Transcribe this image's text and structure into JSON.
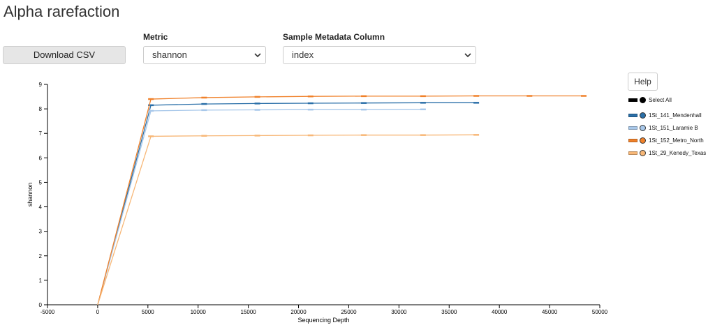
{
  "page": {
    "title": "Alpha rarefaction"
  },
  "controls": {
    "download_label": "Download CSV",
    "metric_label": "Metric",
    "metric_value": "shannon",
    "metadata_label": "Sample Metadata Column",
    "metadata_value": "index",
    "help_label": "Help"
  },
  "legend": {
    "select_all": "Select All",
    "items": [
      {
        "label": "1St_141_Mendenhall",
        "color": "#2a6fa8"
      },
      {
        "label": "1St_151_Laramie B",
        "color": "#a8c8ea"
      },
      {
        "label": "1St_152_Metro_North",
        "color": "#f0812a"
      },
      {
        "label": "1St_29_Kenedy_Texas",
        "color": "#f7b777"
      }
    ]
  },
  "chart_data": {
    "type": "line",
    "xlabel": "Sequencing Depth",
    "ylabel": "shannon",
    "xlim": [
      -5000,
      50000
    ],
    "ylim": [
      0,
      9
    ],
    "xticks": [
      -5000,
      0,
      5000,
      10000,
      15000,
      20000,
      25000,
      30000,
      35000,
      40000,
      45000,
      50000
    ],
    "yticks": [
      0,
      1,
      2,
      3,
      4,
      5,
      6,
      7,
      8,
      9
    ],
    "series": [
      {
        "name": "1St_141_Mendenhall",
        "color": "#2a6fa8",
        "x": [
          0,
          5300,
          10600,
          15900,
          21200,
          26500,
          32400,
          37700
        ],
        "y": [
          0,
          8.15,
          8.2,
          8.22,
          8.23,
          8.24,
          8.25,
          8.25
        ]
      },
      {
        "name": "1St_151_Laramie B",
        "color": "#a8c8ea",
        "x": [
          0,
          5300,
          10600,
          15900,
          21200,
          26500,
          32400
        ],
        "y": [
          0,
          7.92,
          7.95,
          7.96,
          7.97,
          7.97,
          7.98
        ]
      },
      {
        "name": "1St_152_Metro_North",
        "color": "#f0812a",
        "x": [
          0,
          5300,
          10600,
          15900,
          21200,
          26500,
          32400,
          37700,
          43000,
          48400
        ],
        "y": [
          0,
          8.4,
          8.46,
          8.49,
          8.51,
          8.52,
          8.52,
          8.53,
          8.53,
          8.53
        ]
      },
      {
        "name": "1St_29_Kenedy_Texas",
        "color": "#f7b777",
        "x": [
          0,
          5300,
          10600,
          15900,
          21200,
          26500,
          32400,
          37700
        ],
        "y": [
          0,
          6.88,
          6.9,
          6.91,
          6.92,
          6.93,
          6.93,
          6.94
        ]
      }
    ]
  }
}
